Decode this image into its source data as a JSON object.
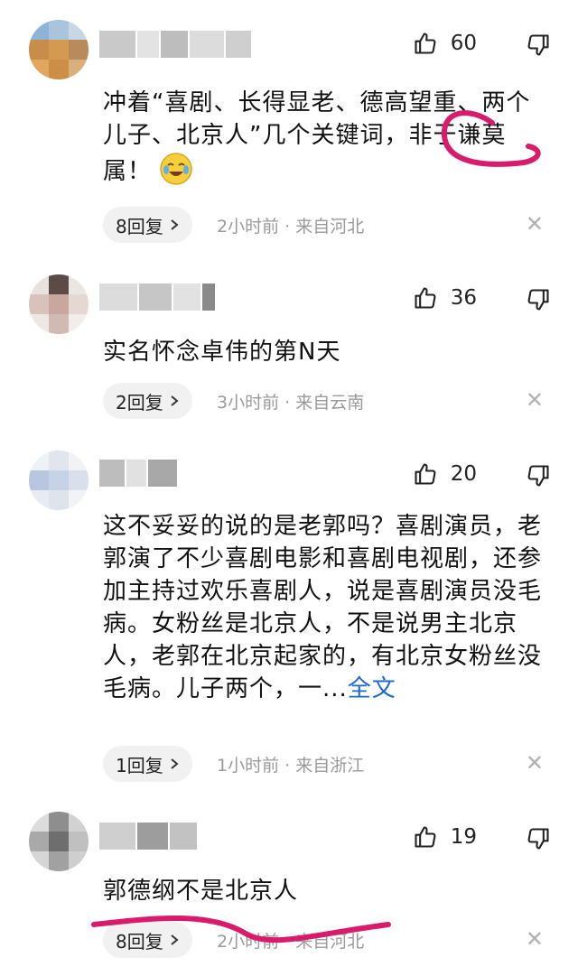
{
  "comments": [
    {
      "likes": "60",
      "text": "冲着“喜剧、长得显老、德高望重、两个儿子、北京人”几个关键词，非于谦莫属！",
      "emoji": "crying-laughing-emoji",
      "reply_label": "8回复",
      "meta": "2小时前 · 来自河北"
    },
    {
      "likes": "36",
      "text": "实名怀念卓伟的第N天",
      "reply_label": "2回复",
      "meta": "3小时前 · 来自云南"
    },
    {
      "likes": "20",
      "text": "这不妥妥的说的是老郭吗？喜剧演员，老郭演了不少喜剧电影和喜剧电视剧，还参加主持过欢乐喜剧人，说是喜剧演员没毛病。女粉丝是北京人，不是说男主北京人，老郭在北京起家的，有北京女粉丝没毛病。儿子两个，一...",
      "more_label": "全文",
      "reply_label": "1回复",
      "meta": "1小时前 · 来自浙江"
    },
    {
      "likes": "19",
      "text": "郭德纲不是北京人",
      "reply_label": "8回复",
      "meta": "2小时前 · 来自河北"
    }
  ],
  "icons": {
    "like": "thumbs-up-icon",
    "dislike": "thumbs-down-icon",
    "close": "close-icon",
    "chevron": "chevron-right-icon"
  },
  "colors": {
    "annotation": "#d81b6a",
    "link": "#1a67d2",
    "meta": "#9a9a9a",
    "pill_bg": "#f1f1f1"
  }
}
